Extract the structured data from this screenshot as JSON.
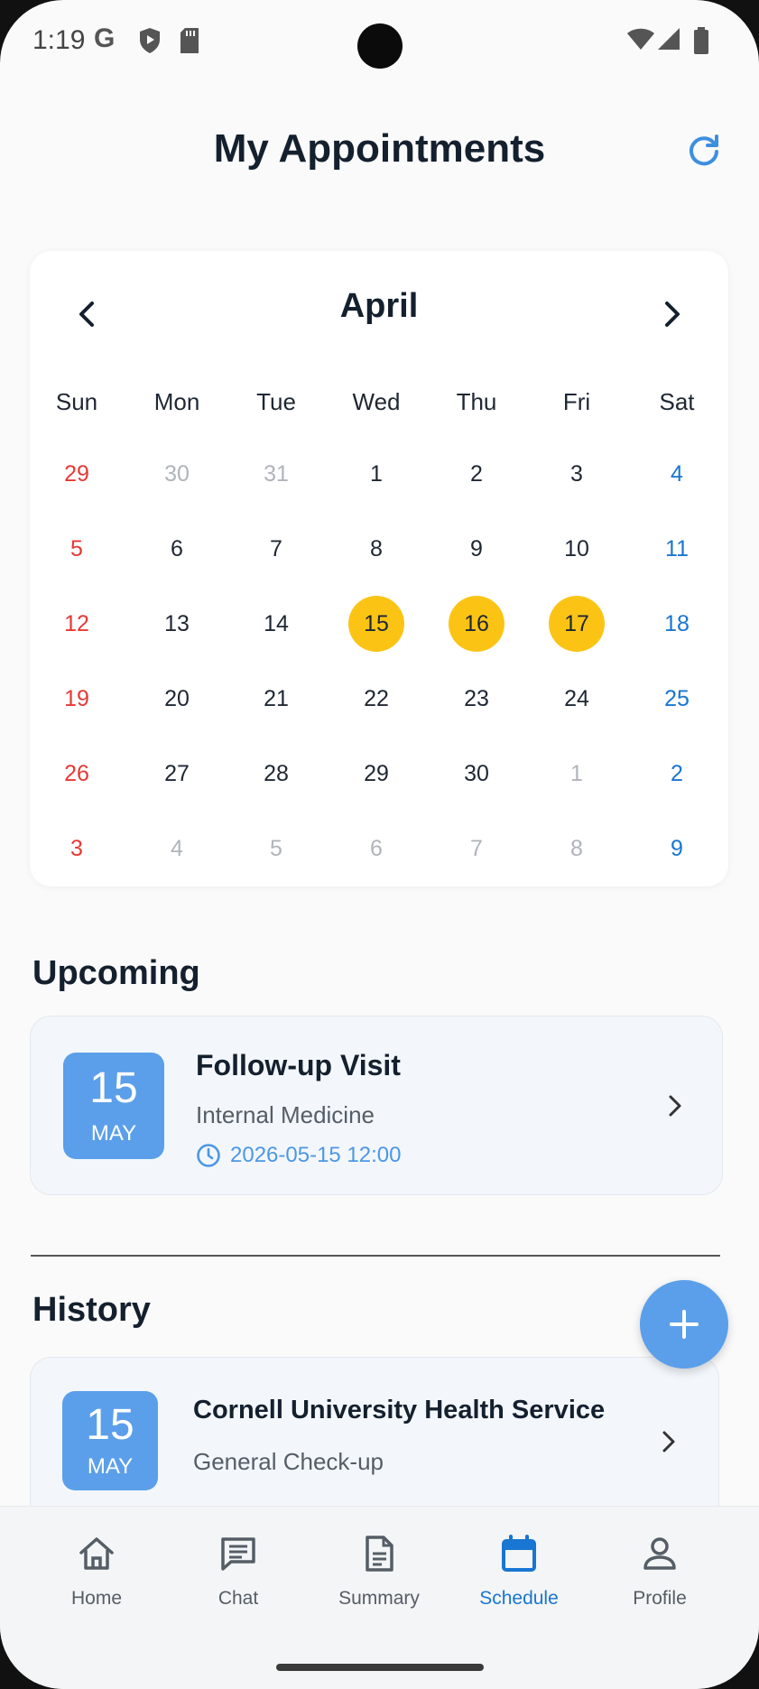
{
  "status_bar": {
    "time": "1:19",
    "g_label": "G"
  },
  "header": {
    "title": "My Appointments"
  },
  "calendar": {
    "month": "April",
    "weekdays": [
      "Sun",
      "Mon",
      "Tue",
      "Wed",
      "Thu",
      "Fri",
      "Sat"
    ],
    "weeks": [
      [
        {
          "d": "29",
          "s": "sun"
        },
        {
          "d": "30",
          "s": "muted"
        },
        {
          "d": "31",
          "s": "muted"
        },
        {
          "d": "1",
          "s": "norm"
        },
        {
          "d": "2",
          "s": "norm"
        },
        {
          "d": "3",
          "s": "norm"
        },
        {
          "d": "4",
          "s": "sat"
        }
      ],
      [
        {
          "d": "5",
          "s": "sun"
        },
        {
          "d": "6",
          "s": "norm"
        },
        {
          "d": "7",
          "s": "norm"
        },
        {
          "d": "8",
          "s": "norm"
        },
        {
          "d": "9",
          "s": "norm"
        },
        {
          "d": "10",
          "s": "norm"
        },
        {
          "d": "11",
          "s": "sat"
        }
      ],
      [
        {
          "d": "12",
          "s": "sun"
        },
        {
          "d": "13",
          "s": "norm"
        },
        {
          "d": "14",
          "s": "norm"
        },
        {
          "d": "15",
          "s": "hl"
        },
        {
          "d": "16",
          "s": "hl"
        },
        {
          "d": "17",
          "s": "hl"
        },
        {
          "d": "18",
          "s": "sat"
        }
      ],
      [
        {
          "d": "19",
          "s": "sun"
        },
        {
          "d": "20",
          "s": "norm"
        },
        {
          "d": "21",
          "s": "norm"
        },
        {
          "d": "22",
          "s": "norm"
        },
        {
          "d": "23",
          "s": "norm"
        },
        {
          "d": "24",
          "s": "norm"
        },
        {
          "d": "25",
          "s": "sat"
        }
      ],
      [
        {
          "d": "26",
          "s": "sun"
        },
        {
          "d": "27",
          "s": "norm"
        },
        {
          "d": "28",
          "s": "norm"
        },
        {
          "d": "29",
          "s": "norm"
        },
        {
          "d": "30",
          "s": "norm"
        },
        {
          "d": "1",
          "s": "muted"
        },
        {
          "d": "2",
          "s": "sat"
        }
      ],
      [
        {
          "d": "3",
          "s": "sun"
        },
        {
          "d": "4",
          "s": "muted"
        },
        {
          "d": "5",
          "s": "muted"
        },
        {
          "d": "6",
          "s": "muted"
        },
        {
          "d": "7",
          "s": "muted"
        },
        {
          "d": "8",
          "s": "muted"
        },
        {
          "d": "9",
          "s": "sat"
        }
      ]
    ]
  },
  "upcoming": {
    "title": "Upcoming",
    "item": {
      "badge_day": "15",
      "badge_month": "MAY",
      "title": "Follow-up Visit",
      "subtitle": "Internal Medicine",
      "datetime": "2026-05-15 12:00"
    }
  },
  "history": {
    "title": "History",
    "item": {
      "badge_day": "15",
      "badge_month": "MAY",
      "title": "Cornell University Health Service",
      "subtitle": "General Check-up"
    }
  },
  "nav": {
    "items": [
      {
        "label": "Home",
        "icon": "home-icon"
      },
      {
        "label": "Chat",
        "icon": "chat-icon"
      },
      {
        "label": "Summary",
        "icon": "document-icon"
      },
      {
        "label": "Schedule",
        "icon": "calendar-icon",
        "active": true
      },
      {
        "label": "Profile",
        "icon": "person-icon"
      }
    ]
  },
  "colors": {
    "accent": "#5b9fea",
    "active_nav": "#1976d2",
    "highlight": "#fbc415",
    "sunday": "#e53935",
    "saturday": "#1976d2"
  }
}
